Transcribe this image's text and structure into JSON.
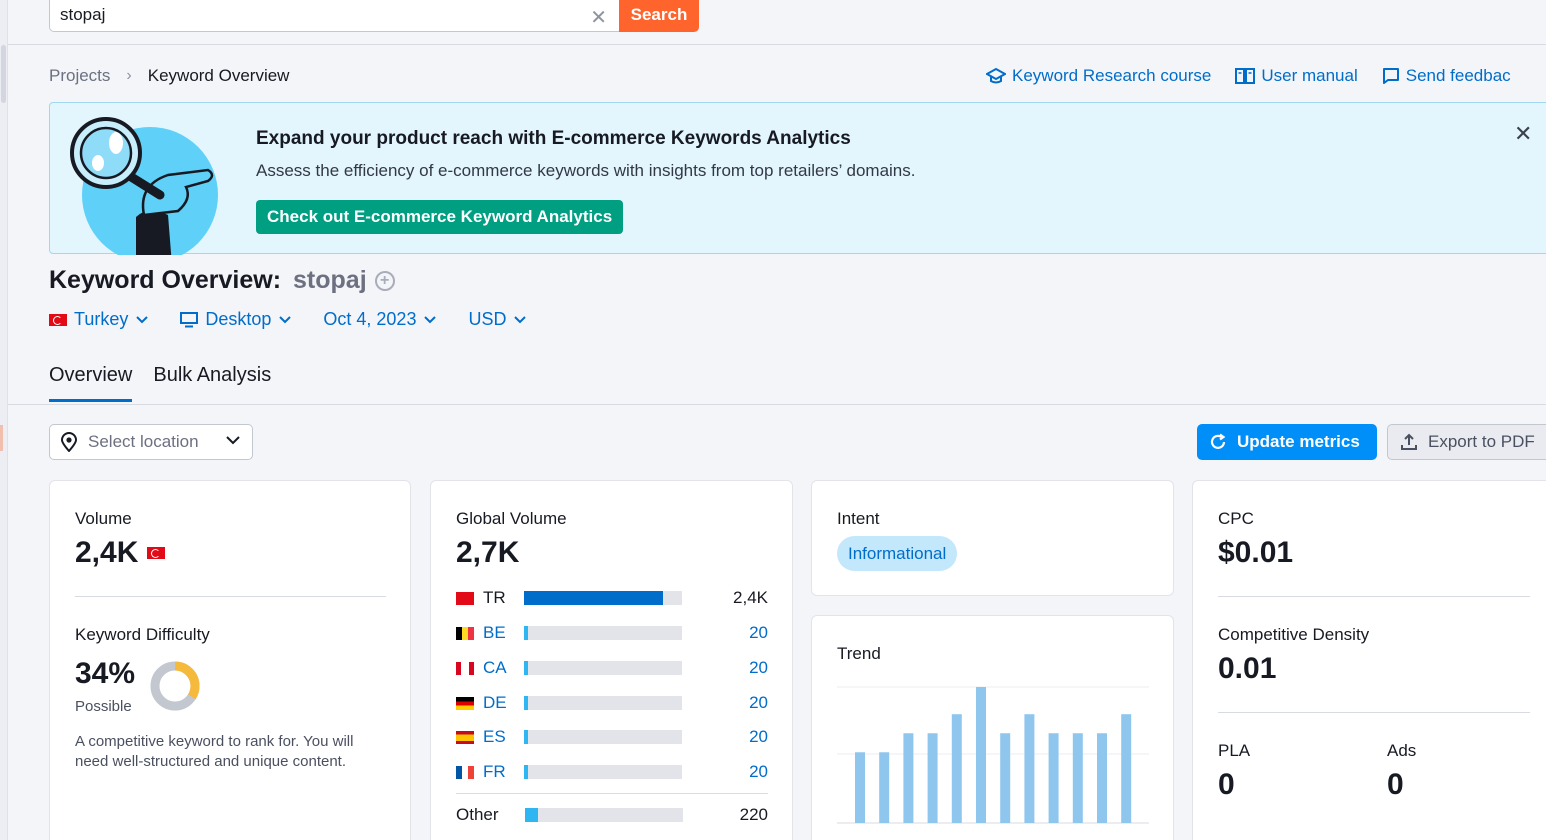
{
  "search": {
    "value": "stopaj",
    "button": "Search"
  },
  "breadcrumb": {
    "root": "Projects",
    "current": "Keyword Overview"
  },
  "help_links": [
    "Keyword Research course",
    "User manual",
    "Send feedbac"
  ],
  "banner": {
    "title": "Expand your product reach with E-commerce Keywords Analytics",
    "text": "Assess the efficiency of e-commerce keywords with insights from top retailers’ domains.",
    "button": "Check out E-commerce Keyword Analytics"
  },
  "title": {
    "prefix": "Keyword Overview:",
    "keyword": "stopaj"
  },
  "filters": {
    "country": "Turkey",
    "device": "Desktop",
    "date": "Oct 4, 2023",
    "currency": "USD"
  },
  "tabs": [
    "Overview",
    "Bulk Analysis"
  ],
  "toolbar": {
    "location_placeholder": "Select location",
    "update": "Update metrics",
    "export": "Export to PDF"
  },
  "volume": {
    "label": "Volume",
    "value": "2,4K",
    "kd_label": "Keyword Difficulty",
    "kd_value": "34%",
    "kd_level": "Possible",
    "kd_percent": 34,
    "kd_desc": "A competitive keyword to rank for. You will need well-structured and unique content."
  },
  "global_volume": {
    "label": "Global Volume",
    "value": "2,7K",
    "countries": [
      {
        "code": "TR",
        "value": "2,4K",
        "fill": 0.88,
        "link": false
      },
      {
        "code": "BE",
        "value": "20",
        "fill": 0.02,
        "link": true
      },
      {
        "code": "CA",
        "value": "20",
        "fill": 0.02,
        "link": true
      },
      {
        "code": "DE",
        "value": "20",
        "fill": 0.02,
        "link": true
      },
      {
        "code": "ES",
        "value": "20",
        "fill": 0.02,
        "link": true
      },
      {
        "code": "FR",
        "value": "20",
        "fill": 0.02,
        "link": true
      }
    ],
    "other": {
      "label": "Other",
      "value": "220",
      "fill": 0.08
    }
  },
  "intent": {
    "label": "Intent",
    "badge": "Informational"
  },
  "trend": {
    "label": "Trend",
    "values": [
      0.52,
      0.52,
      0.66,
      0.66,
      0.8,
      1.0,
      0.66,
      0.8,
      0.66,
      0.66,
      0.66,
      0.8
    ]
  },
  "cpc": {
    "label": "CPC",
    "value": "$0.01",
    "cd_label": "Competitive Density",
    "cd_value": "0.01",
    "pla_label": "PLA",
    "pla_value": "0",
    "ads_label": "Ads",
    "ads_value": "0"
  },
  "colors": {
    "accent": "#006dca",
    "search": "#ff642d",
    "banner_btn": "#009f81",
    "update_btn": "#008ff8",
    "kd_orange": "#f5b93b",
    "bar_tr": "#006dca",
    "bar_other": "#2eb6f3",
    "trend_bar": "#8fc6ee"
  }
}
